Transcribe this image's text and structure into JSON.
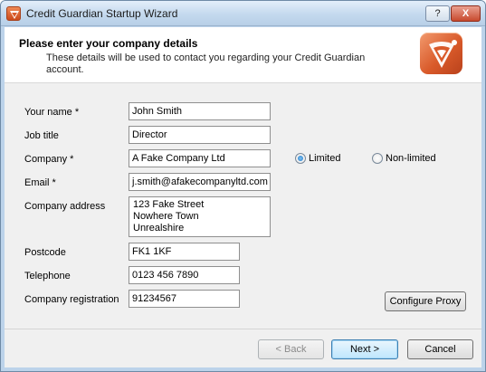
{
  "window": {
    "title": "Credit Guardian Startup Wizard",
    "help_label": "?",
    "close_label": "X"
  },
  "header": {
    "title": "Please enter your company details",
    "subtitle": "These details will be used to contact you regarding your Credit Guardian account."
  },
  "form": {
    "name": {
      "label": "Your name *",
      "value": "John Smith"
    },
    "job_title": {
      "label": "Job title",
      "value": "Director"
    },
    "company": {
      "label": "Company *",
      "value": "A Fake Company Ltd"
    },
    "company_type": {
      "options": [
        {
          "label": "Limited",
          "selected": true
        },
        {
          "label": "Non-limited",
          "selected": false
        }
      ]
    },
    "email": {
      "label": "Email *",
      "value": "j.smith@afakecompanyltd.com"
    },
    "address": {
      "label": "Company address",
      "lines": [
        "123 Fake Street",
        "Nowhere Town",
        "Unrealshire"
      ]
    },
    "postcode": {
      "label": "Postcode",
      "value": "FK1 1KF"
    },
    "telephone": {
      "label": "Telephone",
      "value": "0123 456 7890"
    },
    "registration": {
      "label": "Company registration",
      "value": "91234567"
    }
  },
  "buttons": {
    "configure_proxy": "Configure Proxy",
    "back": "< Back",
    "next": "Next >",
    "cancel": "Cancel"
  },
  "colors": {
    "accent": "#d95a2a",
    "window_frame": "#bcd3ea"
  },
  "icons": {
    "app": "credit-guardian-logo-icon"
  }
}
